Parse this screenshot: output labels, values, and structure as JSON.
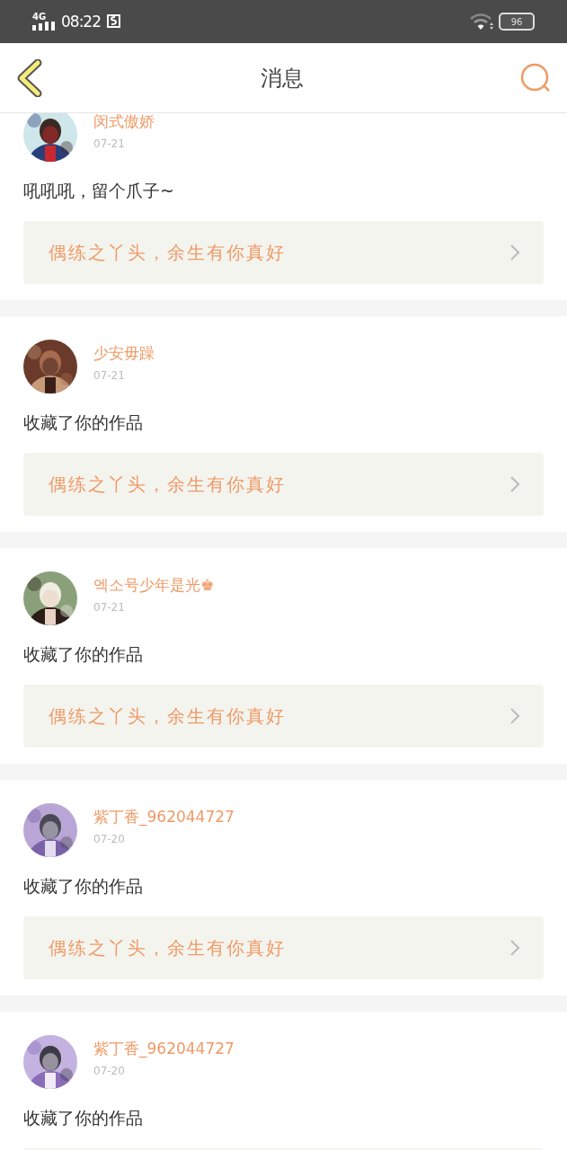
{
  "status_bar": {
    "network": "4G",
    "time": "08:22",
    "battery": "96"
  },
  "header": {
    "title": "消息"
  },
  "messages": [
    {
      "name": "闵式傲娇",
      "date": "07-21",
      "text": "吼吼吼，留个爪子~",
      "work": "偶练之丫头，余生有你真好"
    },
    {
      "name": "少安毋躁",
      "date": "07-21",
      "text": "收藏了你的作品",
      "work": "偶练之丫头，余生有你真好"
    },
    {
      "name": "엑소号少年是光♚",
      "date": "07-21",
      "text": "收藏了你的作品",
      "work": "偶练之丫头，余生有你真好"
    },
    {
      "name": "紫丁香_962044727",
      "date": "07-20",
      "text": "收藏了你的作品",
      "work": "偶练之丫头，余生有你真好"
    },
    {
      "name": "紫丁香_962044727",
      "date": "07-20",
      "text": "收藏了你的作品"
    }
  ]
}
